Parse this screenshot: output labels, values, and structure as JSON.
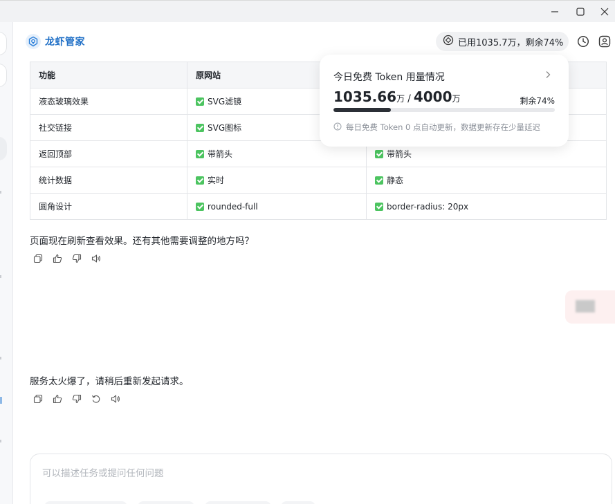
{
  "brand": {
    "name": "龙虾管家"
  },
  "header": {
    "usage_text": "已用1035.7万，剩余74%"
  },
  "table": {
    "headers": [
      "功能",
      "原网站",
      ""
    ],
    "rows": [
      {
        "feature": "液态玻璃效果",
        "orig": "SVG滤镜",
        "new": ""
      },
      {
        "feature": "社交链接",
        "orig": "SVG图标",
        "new": ""
      },
      {
        "feature": "返回顶部",
        "orig": "带箭头",
        "new": "带箭头"
      },
      {
        "feature": "统计数据",
        "orig": "实时",
        "new": "静态"
      },
      {
        "feature": "圆角设计",
        "orig": "rounded-full",
        "new": "border-radius: 20px"
      }
    ]
  },
  "popup": {
    "title": "今日免费 Token 用量情况",
    "used": "1035.66",
    "used_unit": "万",
    "separator": "/",
    "total": "4000",
    "total_unit": "万",
    "remaining": "剩余74%",
    "used_fraction": 0.26,
    "note": "每日免费 Token 0 点自动更新，数据更新存在少量延迟"
  },
  "messages": {
    "msg1": "页面现在刷新查看效果。还有其他需要调整的地方吗？",
    "msg2": "服务太火爆了，请稍后重新发起请求。"
  },
  "input": {
    "placeholder": "可以描述任务或提问任何问题"
  },
  "colors": {
    "brand": "#1f6fc6",
    "check": "#4cc460",
    "bar": "#2b2f36"
  }
}
